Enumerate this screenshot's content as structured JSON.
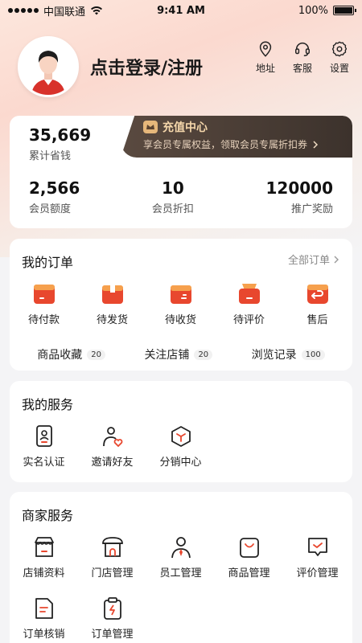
{
  "status_bar": {
    "carrier": "中国联通",
    "time": "9:41 AM",
    "battery": "100%"
  },
  "profile": {
    "login_text": "点击登录/注册"
  },
  "top_actions": [
    {
      "label": "地址",
      "icon": "location-icon"
    },
    {
      "label": "客服",
      "icon": "headset-icon"
    },
    {
      "label": "设置",
      "icon": "gear-icon"
    }
  ],
  "wallet": {
    "saved_value": "35,669",
    "saved_label": "累计省钱",
    "vip_title": "充值中心",
    "vip_sub": "享会员专属权益，领取会员专属折扣券",
    "stats": [
      {
        "value": "2,566",
        "label": "会员额度"
      },
      {
        "value": "10",
        "label": "会员折扣"
      },
      {
        "value": "120000",
        "label": "推广奖励"
      }
    ]
  },
  "orders": {
    "title": "我的订单",
    "more": "全部订单",
    "items": [
      {
        "label": "待付款",
        "icon": "wallet-icon"
      },
      {
        "label": "待发货",
        "icon": "package-icon"
      },
      {
        "label": "待收货",
        "icon": "truck-box-icon"
      },
      {
        "label": "待评价",
        "icon": "review-box-icon"
      },
      {
        "label": "售后",
        "icon": "return-icon"
      }
    ],
    "favorites": [
      {
        "label": "商品收藏",
        "count": "20"
      },
      {
        "label": "关注店铺",
        "count": "20"
      },
      {
        "label": "浏览记录",
        "count": "100"
      }
    ]
  },
  "services": {
    "title": "我的服务",
    "items": [
      {
        "label": "实名认证",
        "icon": "id-card-icon"
      },
      {
        "label": "邀请好友",
        "icon": "invite-friend-icon"
      },
      {
        "label": "分销中心",
        "icon": "distribution-icon"
      }
    ]
  },
  "merchant": {
    "title": "商家服务",
    "items": [
      {
        "label": "店铺资料",
        "icon": "store-icon"
      },
      {
        "label": "门店管理",
        "icon": "shop-front-icon"
      },
      {
        "label": "员工管理",
        "icon": "staff-icon"
      },
      {
        "label": "商品管理",
        "icon": "shopping-bag-icon"
      },
      {
        "label": "评价管理",
        "icon": "comment-check-icon"
      },
      {
        "label": "订单核销",
        "icon": "document-icon"
      },
      {
        "label": "订单管理",
        "icon": "clipboard-icon"
      }
    ]
  },
  "colors": {
    "accent": "#e8472e",
    "vip_dark": "#3c322c",
    "vip_gold": "#f5d7ab"
  }
}
